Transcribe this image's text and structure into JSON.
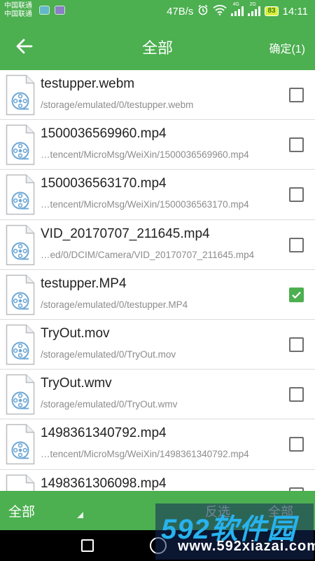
{
  "status_bar": {
    "carrier_1": "中国联通",
    "carrier_2": "中国联通",
    "speed": "47B/s",
    "network_tag": "4G",
    "network_tag_2": "2G",
    "battery": "83",
    "time": "14:11"
  },
  "app_bar": {
    "title": "全部",
    "confirm_label": "确定(1)"
  },
  "files": [
    {
      "name": "testupper.webm",
      "path": "/storage/emulated/0/testupper.webm",
      "checked": false
    },
    {
      "name": "1500036569960.mp4",
      "path": "…tencent/MicroMsg/WeiXin/1500036569960.mp4",
      "checked": false
    },
    {
      "name": "1500036563170.mp4",
      "path": "…tencent/MicroMsg/WeiXin/1500036563170.mp4",
      "checked": false
    },
    {
      "name": "VID_20170707_211645.mp4",
      "path": "…ed/0/DCIM/Camera/VID_20170707_211645.mp4",
      "checked": false
    },
    {
      "name": "testupper.MP4",
      "path": "/storage/emulated/0/testupper.MP4",
      "checked": true
    },
    {
      "name": "TryOut.mov",
      "path": "/storage/emulated/0/TryOut.mov",
      "checked": false
    },
    {
      "name": "TryOut.wmv",
      "path": "/storage/emulated/0/TryOut.wmv",
      "checked": false
    },
    {
      "name": "1498361340792.mp4",
      "path": "…tencent/MicroMsg/WeiXin/1498361340792.mp4",
      "checked": false
    },
    {
      "name": "1498361306098.mp4",
      "path": "",
      "checked": false
    }
  ],
  "bottom_bar": {
    "filter_label": "全部",
    "invert_label": "反选",
    "select_all_label": "全部"
  },
  "watermark": {
    "brand": "592软件园",
    "site": "www.592xiazai.com"
  },
  "colors": {
    "accent": "#4caf50",
    "icon_blue": "#6fa8d6"
  },
  "icons": {
    "back": "arrow-left-icon",
    "file": "video-file-icon",
    "check": "checkmark-icon"
  }
}
